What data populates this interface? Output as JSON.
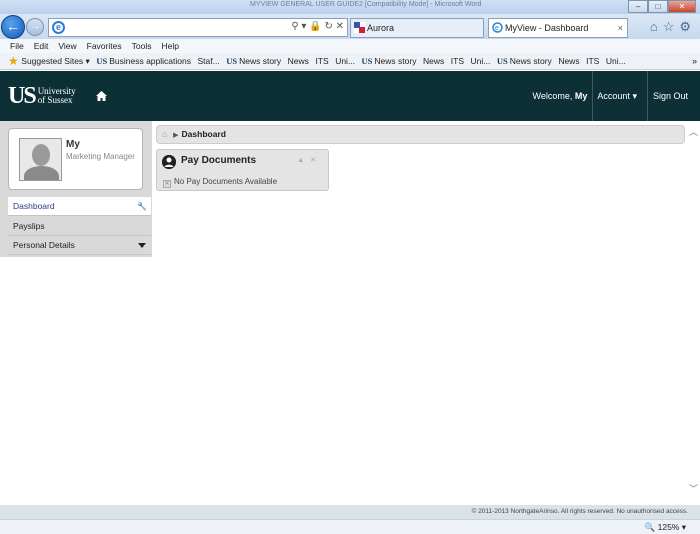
{
  "browser": {
    "window_title": "MYVIEW GENERAL USER GUIDE2 [Compatibility Mode] - Microsoft Word",
    "tabs": [
      {
        "label": "Aurora"
      },
      {
        "label": "MyView - Dashboard"
      }
    ],
    "menu": [
      "File",
      "Edit",
      "View",
      "Favorites",
      "Tools",
      "Help"
    ],
    "favorites": [
      "Suggested Sites",
      "Business applications",
      "Staf...",
      "News story",
      "News",
      "ITS",
      "Uni...",
      "News story",
      "News",
      "ITS",
      "Uni...",
      "News story",
      "News",
      "ITS",
      "Uni..."
    ],
    "zoom": "125%"
  },
  "header": {
    "logo_mark": "US",
    "logo_name_1": "University",
    "logo_name_2": "of Sussex",
    "welcome": "Welcome,",
    "user": "My",
    "account": "Account",
    "signout": "Sign Out"
  },
  "profile": {
    "name": "My",
    "role": "Marketing Manager"
  },
  "sidebar": {
    "items": [
      {
        "label": "Dashboard"
      },
      {
        "label": "Payslips"
      },
      {
        "label": "Personal Details"
      }
    ]
  },
  "breadcrumb": {
    "current": "Dashboard"
  },
  "widget": {
    "title": "Pay Documents",
    "empty_text": "No Pay Documents Available"
  },
  "footer": {
    "text": "© 2011-2013 NorthgateArinso. All rights reserved. No unauthorised access."
  }
}
